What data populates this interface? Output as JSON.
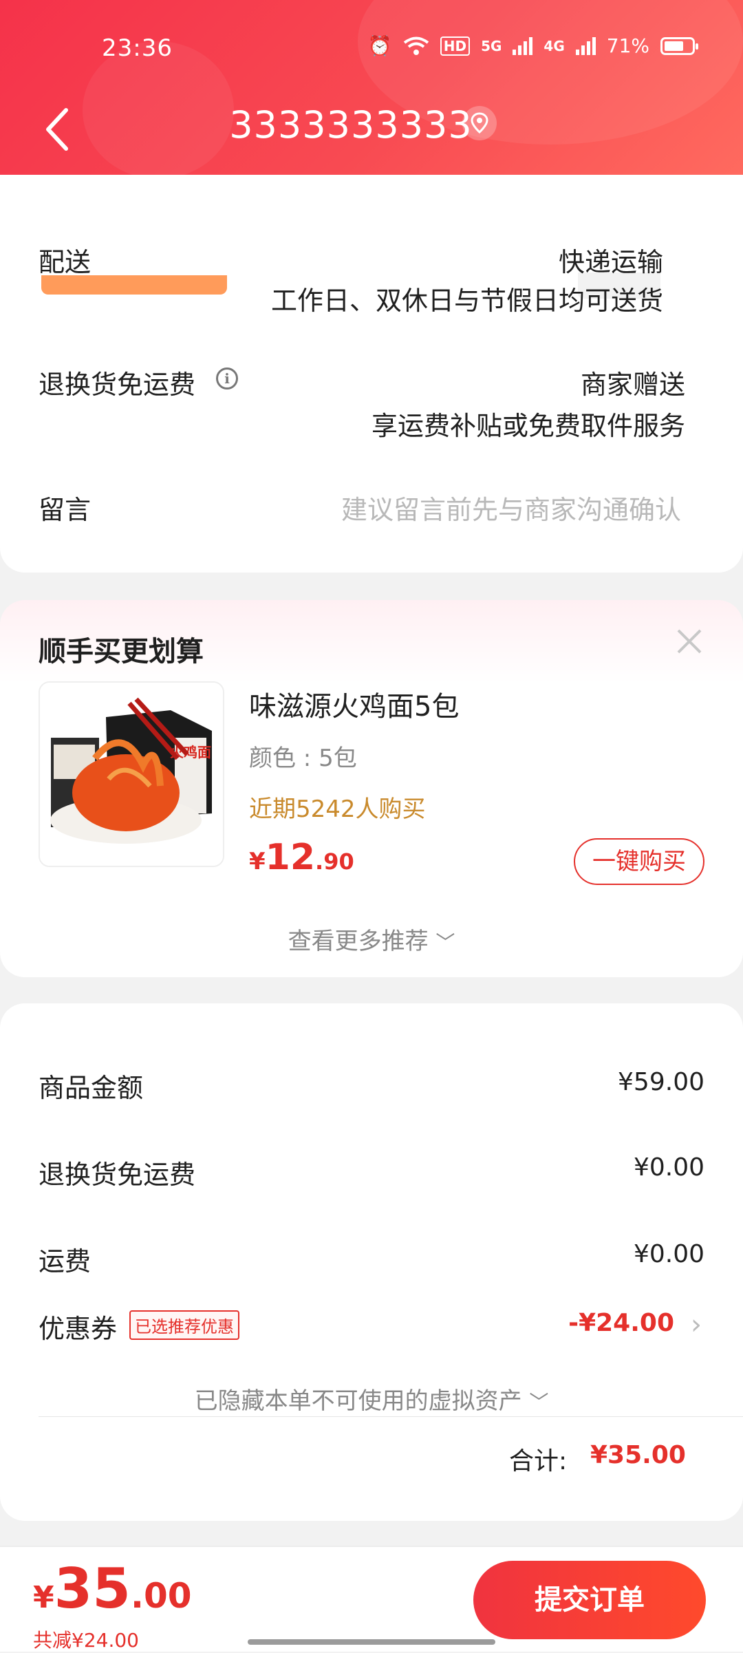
{
  "status_bar": {
    "time": "23:36",
    "hd": "HD",
    "net1": "5G",
    "net2": "4G",
    "battery": "71%",
    "battery_level": 0.71
  },
  "header": {
    "title": "3333333333"
  },
  "delivery": {
    "label": "配送",
    "method": "快递运输",
    "schedule": "工作日、双休日与节假日均可送货",
    "return_label": "退换货免运费",
    "return_value": "商家赠送",
    "return_desc": "享运费补贴或免费取件服务",
    "message_label": "留言",
    "message_placeholder": "建议留言前先与商家沟通确认"
  },
  "recommend": {
    "title": "顺手买更划算",
    "product": {
      "name": "味滋源火鸡面5包",
      "color": "颜色 : 5包",
      "bought": "近期5242人购买",
      "price_currency": "¥",
      "price_int": "12",
      "price_dec": ".90",
      "buy_label": "一键购买",
      "pack_text": "火鸡面"
    },
    "more": "查看更多推荐"
  },
  "summary": {
    "goods_label": "商品金额",
    "goods_value": "¥59.00",
    "return_label": "退换货免运费",
    "return_value": "¥0.00",
    "shipping_label": "运费",
    "shipping_value": "¥0.00",
    "coupon_label": "优惠券",
    "coupon_tag": "已选推荐优惠",
    "coupon_value": "-¥24.00",
    "hidden_assets": "已隐藏本单不可使用的虚拟资产",
    "total_label": "合计:",
    "total_value": "¥35.00"
  },
  "bottom": {
    "currency": "¥",
    "price_int": "35",
    "price_dec": ".00",
    "saved": "共减¥24.00",
    "submit": "提交订单"
  },
  "colors": {
    "accent": "#e5302b",
    "header_start": "#f5324a",
    "header_end": "#ff6a5f",
    "bought": "#c98a2c"
  }
}
